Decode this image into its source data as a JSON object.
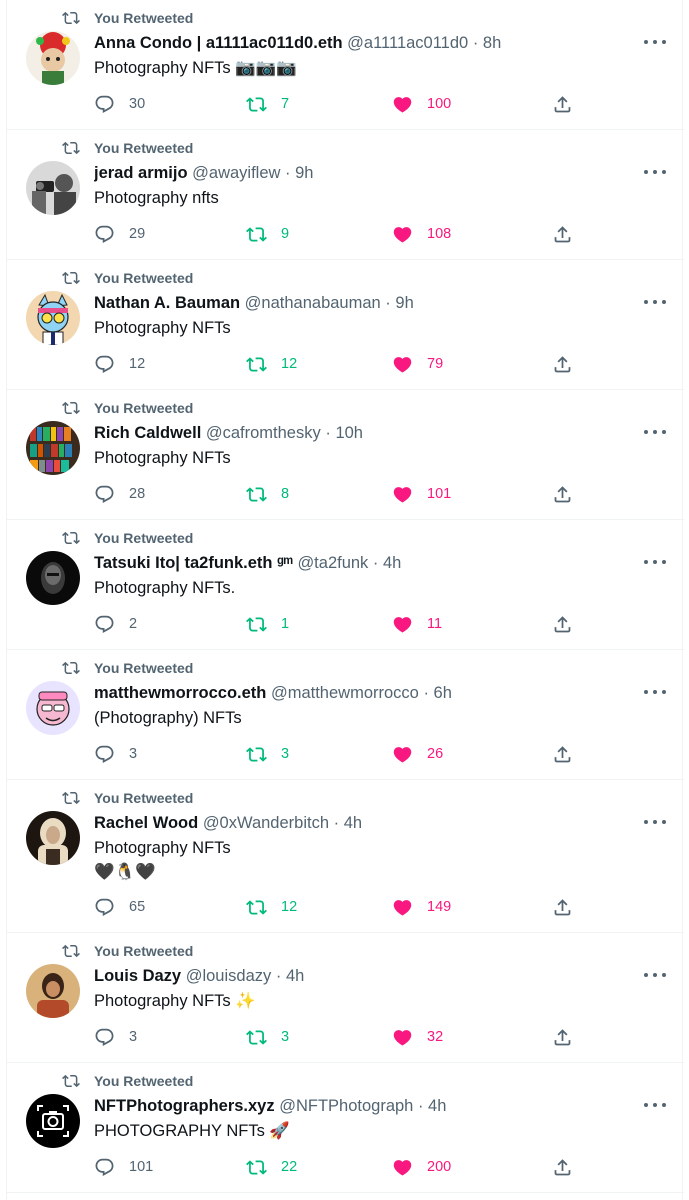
{
  "retweet_label": "You Retweeted",
  "colors": {
    "retweet": "#00ba7c",
    "like": "#f91880",
    "muted": "#536471",
    "text": "#0f1419"
  },
  "tweets": [
    {
      "name": "Anna Condo | a1111ac011d0.eth",
      "handle": "@a1111ac011d0",
      "dot": "·",
      "time": "8h",
      "text": "Photography NFTs 📷📷📷",
      "replies": "30",
      "retweets": "7",
      "likes": "100",
      "avatar": "colorful-portrait"
    },
    {
      "name": "jerad armijo",
      "handle": "@awayiflew",
      "dot": "·",
      "time": "9h",
      "text": "Photography nfts",
      "replies": "29",
      "retweets": "9",
      "likes": "108",
      "avatar": "bw-photographer"
    },
    {
      "name": "Nathan A. Bauman",
      "handle": "@nathanabauman",
      "dot": "·",
      "time": "9h",
      "text": "Photography NFTs",
      "replies": "12",
      "retweets": "12",
      "likes": "79",
      "avatar": "cartoon-cat"
    },
    {
      "name": "Rich Caldwell",
      "handle": "@cafromthesky",
      "dot": "·",
      "time": "10h",
      "text": "Photography NFTs",
      "replies": "28",
      "retweets": "8",
      "likes": "101",
      "avatar": "bookshelf"
    },
    {
      "name": "Tatsuki Ito| ta2funk.eth ᵍᵐ",
      "handle": "@ta2funk",
      "dot": "·",
      "time": "4h",
      "text": "Photography NFTs.",
      "replies": "2",
      "retweets": "1",
      "likes": "11",
      "avatar": "dark-portrait"
    },
    {
      "name": "matthewmorrocco.eth",
      "handle": "@matthewmorrocco",
      "dot": "·",
      "time": "6h",
      "text": "(Photography) NFTs",
      "replies": "3",
      "retweets": "3",
      "likes": "26",
      "avatar": "pink-cartoon"
    },
    {
      "name": "Rachel Wood",
      "handle": "@0xWanderbitch",
      "dot": "·",
      "time": "4h",
      "text": "Photography NFTs\n🖤🐧🖤",
      "replies": "65",
      "retweets": "12",
      "likes": "149",
      "avatar": "blonde-portrait"
    },
    {
      "name": "Louis Dazy",
      "handle": "@louisdazy",
      "dot": "·",
      "time": "4h",
      "text": "Photography NFTs ✨",
      "replies": "3",
      "retweets": "3",
      "likes": "32",
      "avatar": "warm-portrait"
    },
    {
      "name": "NFTPhotographers.xyz",
      "handle": "@NFTPhotograph",
      "dot": "·",
      "time": "4h",
      "text": "PHOTOGRAPHY NFTs 🚀",
      "replies": "101",
      "retweets": "22",
      "likes": "200",
      "avatar": "camera-logo"
    }
  ]
}
